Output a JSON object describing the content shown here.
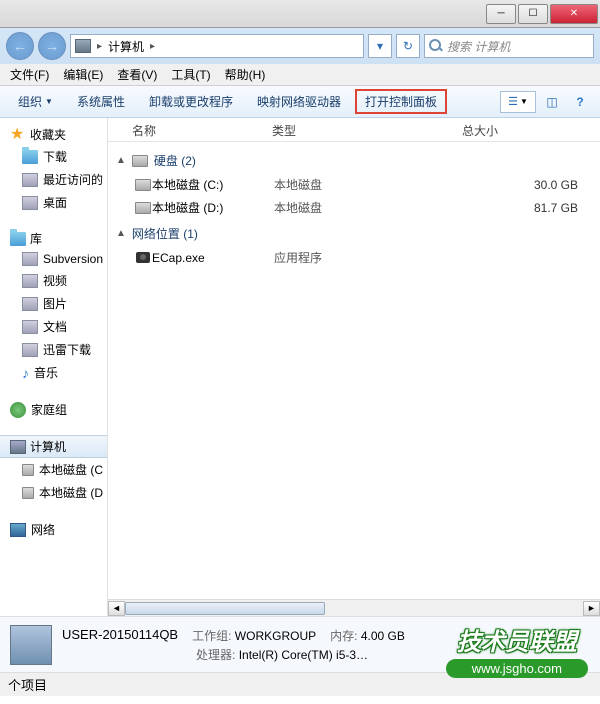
{
  "titlebar": {
    "min": "─",
    "max": "☐",
    "close": "✕"
  },
  "address": {
    "location": "计算机",
    "sep": "▸",
    "dd": "▾",
    "search_placeholder": "搜索 计算机",
    "refresh": "↻"
  },
  "menubar": [
    {
      "label": "文件(F)"
    },
    {
      "label": "编辑(E)"
    },
    {
      "label": "查看(V)"
    },
    {
      "label": "工具(T)"
    },
    {
      "label": "帮助(H)"
    }
  ],
  "toolbar": {
    "organize": "组织",
    "dd": "▼",
    "items": [
      {
        "label": "系统属性"
      },
      {
        "label": "卸载或更改程序"
      },
      {
        "label": "映射网络驱动器"
      },
      {
        "label": "打开控制面板",
        "highlighted": true
      }
    ],
    "help": "?"
  },
  "columns": {
    "name": "名称",
    "type": "类型",
    "size": "总大小"
  },
  "sidebar": {
    "favorites": {
      "header": "收藏夹",
      "items": [
        "下载",
        "最近访问的",
        "桌面"
      ]
    },
    "libraries": {
      "header": "库",
      "items": [
        "Subversion",
        "视频",
        "图片",
        "文档",
        "迅雷下载",
        "音乐"
      ]
    },
    "homegroup": "家庭组",
    "computer": {
      "header": "计算机",
      "items": [
        "本地磁盘 (C",
        "本地磁盘 (D"
      ]
    },
    "network": "网络"
  },
  "groups": [
    {
      "title": "硬盘 (2)",
      "rows": [
        {
          "name": "本地磁盘 (C:)",
          "type": "本地磁盘",
          "size": "30.0 GB",
          "icon": "drive"
        },
        {
          "name": "本地磁盘 (D:)",
          "type": "本地磁盘",
          "size": "81.7 GB",
          "icon": "drive"
        }
      ]
    },
    {
      "title": "网络位置 (1)",
      "rows": [
        {
          "name": "ECap.exe",
          "type": "应用程序",
          "size": "",
          "icon": "camera"
        }
      ]
    }
  ],
  "details": {
    "name": "USER-20150114QB",
    "workgroup_label": "工作组:",
    "workgroup": "WORKGROUP",
    "mem_label": "内存:",
    "mem": "4.00 GB",
    "cpu_label": "处理器:",
    "cpu": "Intel(R) Core(TM) i5-3…"
  },
  "statusbar": "个项目",
  "watermark": {
    "title": "技术员联盟",
    "url": "www.jsgho.com"
  }
}
